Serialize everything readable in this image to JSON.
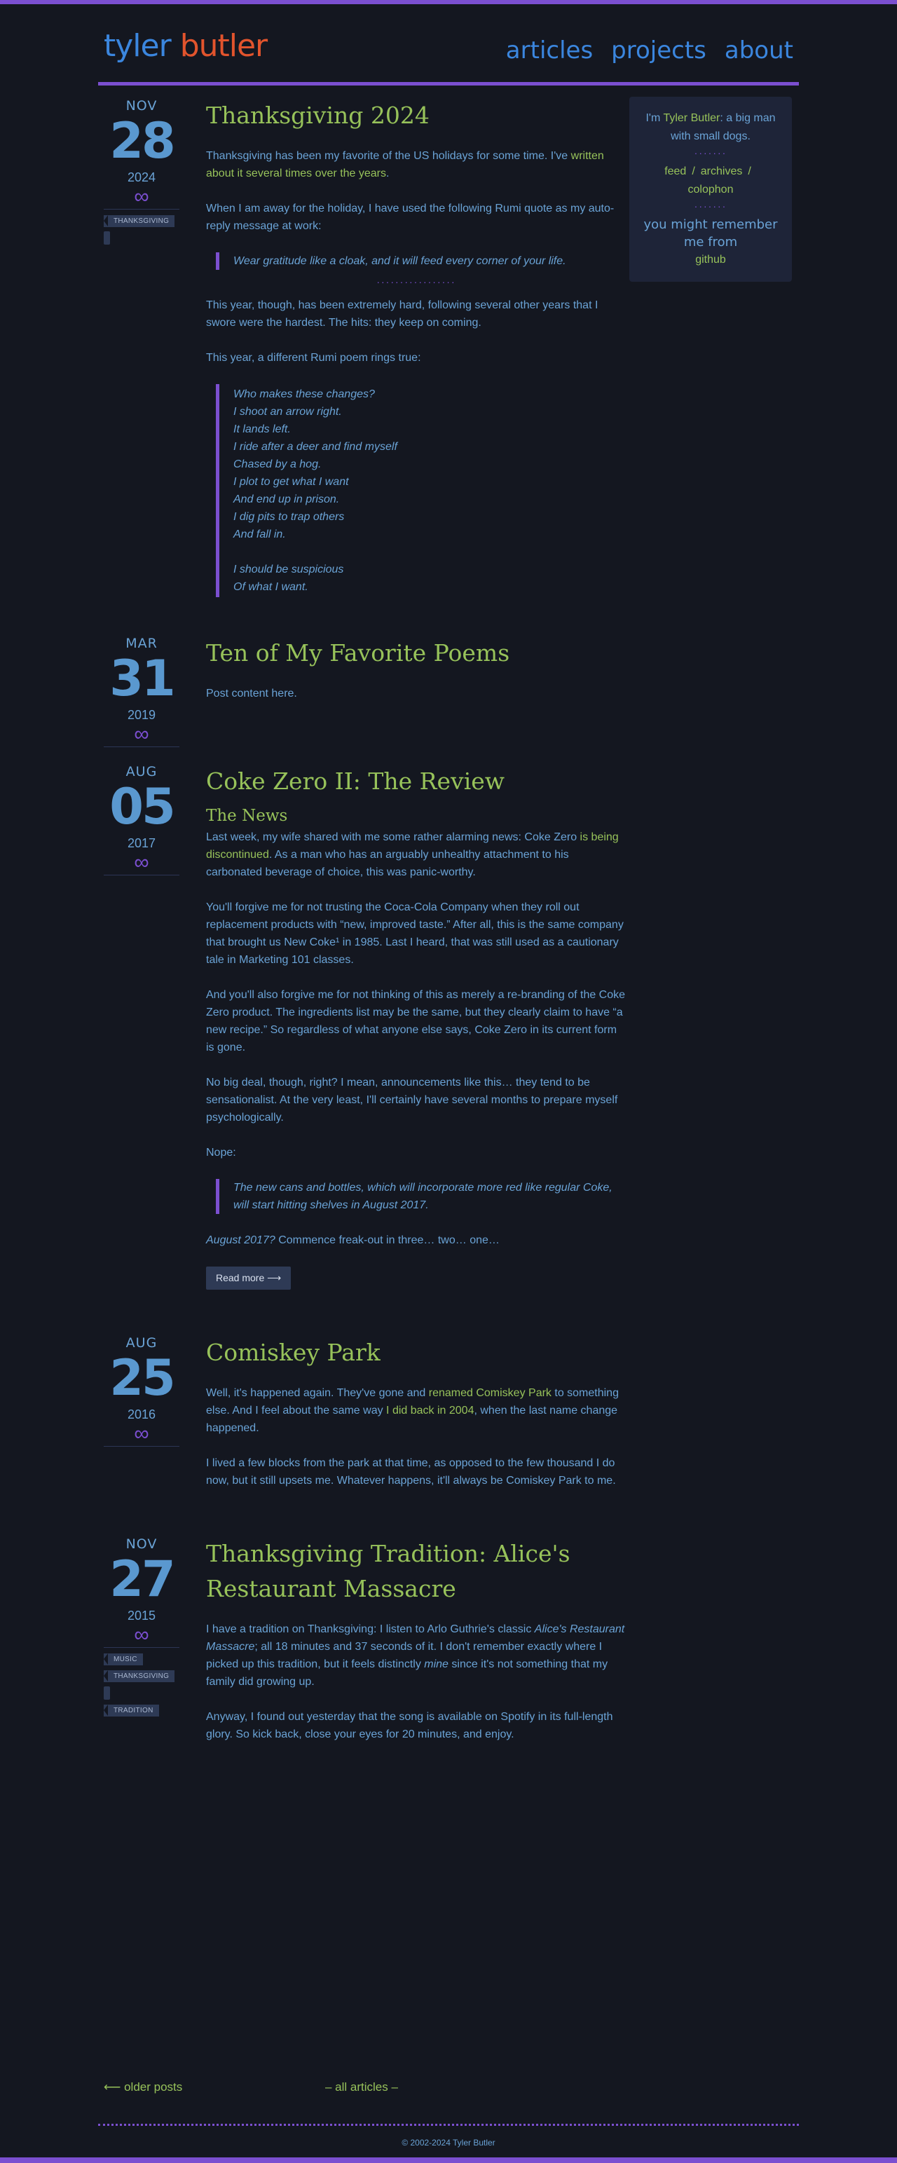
{
  "header": {
    "logo_first": "tyler",
    "logo_last": "butler",
    "nav": [
      "articles",
      "projects",
      "about"
    ]
  },
  "sidebar": {
    "bio_pre": "I'm ",
    "bio_name": "Tyler Butler",
    "bio_post": ": a big man with small dogs.",
    "dots": "·······",
    "links": [
      "feed",
      "archives",
      "colophon"
    ],
    "remember": "you might remember me from",
    "github": "github"
  },
  "posts": [
    {
      "month": "NOV",
      "day": "28",
      "year": "2024",
      "infinity": "∞",
      "tags": [
        "THANKSGIVING"
      ],
      "title": "Thanksgiving 2024",
      "p1_pre": "Thanksgiving has been my favorite of the US holidays for some time. I've ",
      "p1_link": "written about it several times over the years",
      "p1_post": ".",
      "p2": "When I am away for the holiday, I have used the following Rumi quote as my auto-reply message at work:",
      "quote1": "Wear gratitude like a cloak, and it will feed every corner of your life.",
      "dots": "·················",
      "p3": "This year, though, has been extremely hard, following several other years that I swore were the hardest. The hits: they keep on coming.",
      "p4": "This year, a different Rumi poem rings true:",
      "poem_lines": [
        "Who makes these changes?",
        "I shoot an arrow right.",
        "It lands left.",
        "I ride after a deer and find myself",
        "Chased by a hog.",
        "I plot to get what I want",
        "And end up in prison.",
        "I dig pits to trap others",
        "And fall in."
      ],
      "poem_lines2": [
        "I should be suspicious",
        "Of what I want."
      ]
    },
    {
      "month": "MAR",
      "day": "31",
      "year": "2019",
      "infinity": "∞",
      "title": "Ten of My Favorite Poems",
      "p1": "Post content here."
    },
    {
      "month": "AUG",
      "day": "05",
      "year": "2017",
      "infinity": "∞",
      "title": "Coke Zero II: The Review",
      "subtitle": "The News",
      "p1_pre": "Last week, my wife shared with me some rather alarming news: Coke Zero ",
      "p1_link": "is being discontinued",
      "p1_post": ". As a man who has an arguably unhealthy attachment to his carbonated beverage of choice, this was panic-worthy.",
      "p2": "You'll forgive me for not trusting the Coca-Cola Company when they roll out replacement products with “new, improved taste.” After all, this is the same company that brought us New Coke¹ in 1985. Last I heard, that was still used as a cautionary tale in Marketing 101 classes.",
      "p3": "And you'll also forgive me for not thinking of this as merely a re-branding of the Coke Zero product. The ingredients list may be the same, but they clearly claim to have “a new recipe.” So regardless of what anyone else says, Coke Zero in its current form is gone.",
      "p4": "No big deal, though, right? I mean, announcements like this… they tend to be sensationalist. At the very least, I'll certainly have several months to prepare myself psychologically.",
      "p5": "Nope:",
      "quote": "The new cans and bottles, which will incorporate more red like regular Coke, will start hitting shelves in August 2017.",
      "p6_em": "August 2017?",
      "p6_post": " Commence freak-out in three… two… one…",
      "readmore": "Read more ⟶"
    },
    {
      "month": "AUG",
      "day": "25",
      "year": "2016",
      "infinity": "∞",
      "title": "Comiskey Park",
      "p1_pre": "Well, it's happened again. They've gone and ",
      "p1_link1": "renamed Comiskey Park",
      "p1_mid": " to something else. And I feel about the same way ",
      "p1_link2": "I did back in 2004",
      "p1_post": ", when the last name change happened.",
      "p2": "I lived a few blocks from the park at that time, as opposed to the few thousand I do now, but it still upsets me. Whatever happens, it'll always be Comiskey Park to me."
    },
    {
      "month": "NOV",
      "day": "27",
      "year": "2015",
      "infinity": "∞",
      "tags": [
        "MUSIC",
        "THANKSGIVING",
        "TRADITION"
      ],
      "title": "Thanksgiving Tradition: Alice's Restaurant Massacre",
      "p1_pre": "I have a tradition on Thanksgiving: I listen to Arlo Guthrie's classic ",
      "p1_em": "Alice's Restaurant Massacre",
      "p1_mid": "; all 18 minutes and 37 seconds of it. I don't remember exactly where I picked up this tradition, but it feels distinctly ",
      "p1_em2": "mine",
      "p1_post": " since it's not something that my family did growing up.",
      "p2": "Anyway, I found out yesterday that the song is available on Spotify in its full-length glory. So kick back, close your eyes for 20 minutes, and enjoy."
    }
  ],
  "footer": {
    "older": "⟵ older posts",
    "all": "– all articles –",
    "copyright": "© 2002-2024 Tyler Butler"
  },
  "colors": {
    "accent": "#7b4fd0",
    "link": "#97c25a",
    "text": "#6aa3d6",
    "logo_first": "#3b86de",
    "logo_last": "#e2542d",
    "background": "#141720"
  }
}
